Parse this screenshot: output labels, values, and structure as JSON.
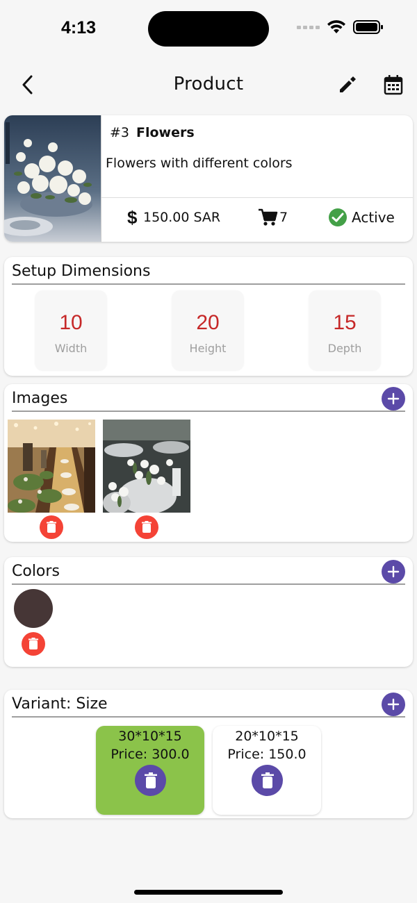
{
  "status_bar": {
    "time": "4:13"
  },
  "app_bar": {
    "title": "Product",
    "back_icon": "chevron-left-icon",
    "edit_icon": "pencil-icon",
    "calendar_icon": "calendar-icon"
  },
  "product": {
    "id_label": "#3",
    "name": "Flowers",
    "description": "Flowers with different colors",
    "price": "150.00 SAR",
    "cart_count": "7",
    "status": "Active",
    "status_color": "#43a047"
  },
  "dimensions": {
    "title": "Setup Dimensions",
    "items": [
      {
        "value": "10",
        "label": "Width"
      },
      {
        "value": "20",
        "label": "Height"
      },
      {
        "value": "15",
        "label": "Depth"
      }
    ],
    "value_color": "#c62828"
  },
  "images": {
    "title": "Images"
  },
  "colors": {
    "title": "Colors",
    "swatch": "#463636"
  },
  "variants": {
    "title": "Variant: Size",
    "items": [
      {
        "size": "30*10*15",
        "price": "Price: 300.0",
        "bg": "#8bc34a"
      },
      {
        "size": "20*10*15",
        "price": "Price: 150.0",
        "bg": "#ffffff"
      }
    ]
  },
  "colors_theme": {
    "accent": "#5b4aa8",
    "danger": "#f44336"
  }
}
